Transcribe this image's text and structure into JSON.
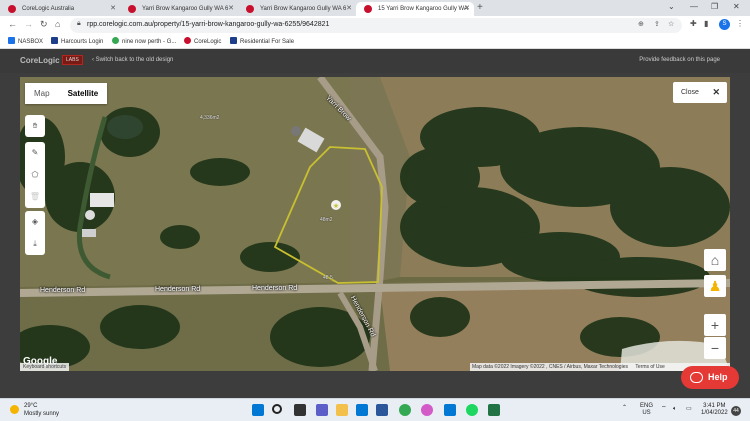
{
  "browser": {
    "tabs": [
      {
        "title": "CoreLogic Australia"
      },
      {
        "title": "Yarri Brow Kangaroo Gully WA 6"
      },
      {
        "title": "Yarri Brow Kangaroo Gully WA 6"
      },
      {
        "title": "15 Yarri Brow Kangaroo Gully WA"
      }
    ],
    "url": "rpp.corelogic.com.au/property/15-yarri-brow-kangaroo-gully-wa-6255/9642821",
    "profile_initial": "S",
    "bookmarks": [
      {
        "label": "NASBOX",
        "color": "#1a73e8"
      },
      {
        "label": "Harcourts Login",
        "color": "#1d3f8a"
      },
      {
        "label": "nine now perth - G...",
        "color": "#34a853"
      },
      {
        "label": "CoreLogic",
        "color": "#c8102e"
      },
      {
        "label": "Residential For Sale",
        "color": "#1d3f8a"
      }
    ]
  },
  "header": {
    "logo": "CoreLogic",
    "labs": "LABS",
    "switch_text": "Switch back to the old design",
    "feedback_text": "Provide feedback on this page"
  },
  "map": {
    "types": [
      "Map",
      "Satellite"
    ],
    "selected_type": "Satellite",
    "close_label": "Close",
    "road_labels": {
      "henderson_1": "Henderson Rd",
      "henderson_2": "Henderson Rd",
      "henderson_3": "Henderson Rd",
      "henderson_4": "Henderson Rd",
      "yarri_brow": "Yarri Brow"
    },
    "plot_labels": {
      "area": "4,336m2",
      "dim_bottom": "48.5",
      "dim_side": "48m2"
    },
    "google": "Google",
    "keyboard_shortcuts": "Keyboard shortcuts",
    "attribution": "Map data ©2022 Imagery ©2022 , CNES / Airbus, Maxar Technologies",
    "terms": "Terms of Use",
    "tools": [
      "hand-icon",
      "pencil-icon",
      "polygon-icon",
      "trash-icon",
      "layers-icon",
      "download-icon"
    ]
  },
  "help": {
    "label": "Help"
  },
  "taskbar": {
    "temp": "29°C",
    "condition": "Mostly sunny",
    "lang_1": "ENG",
    "lang_2": "US",
    "time": "3:41 PM",
    "date": "1/04/2022",
    "notifications": "44"
  }
}
